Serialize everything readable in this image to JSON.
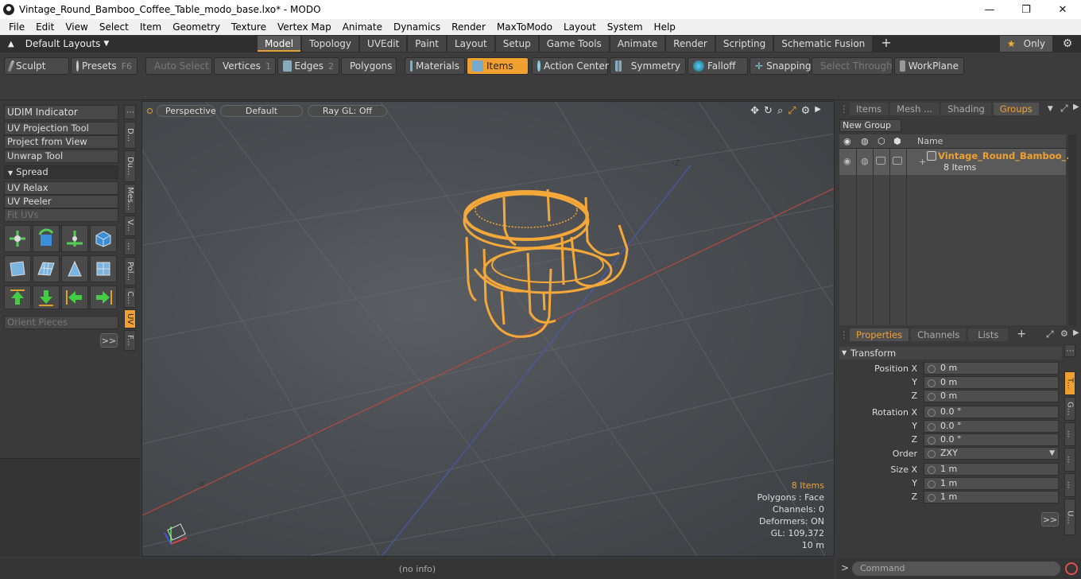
{
  "window": {
    "title": "Vintage_Round_Bamboo_Coffee_Table_modo_base.lxo* - MODO",
    "controls": [
      "—",
      "❐",
      "✕"
    ]
  },
  "menu": [
    "File",
    "Edit",
    "View",
    "Select",
    "Item",
    "Geometry",
    "Texture",
    "Vertex Map",
    "Animate",
    "Dynamics",
    "Render",
    "MaxToModo",
    "Layout",
    "System",
    "Help"
  ],
  "layouts": {
    "label": "Default Layouts"
  },
  "tabs": [
    "Model",
    "Topology",
    "UVEdit",
    "Paint",
    "Layout",
    "Setup",
    "Game Tools",
    "Animate",
    "Render",
    "Scripting",
    "Schematic Fusion"
  ],
  "active_tab": "Model",
  "only_label": "Only",
  "toolbar": {
    "sculpt": "Sculpt",
    "presets": "Presets",
    "presets_key": "F6",
    "auto_select": "Auto Select",
    "vertices": "Vertices",
    "vertices_key": "1",
    "edges": "Edges",
    "edges_key": "2",
    "polygons": "Polygons",
    "materials": "Materials",
    "items": "Items",
    "action_center": "Action Center",
    "symmetry": "Symmetry",
    "falloff": "Falloff",
    "snapping": "Snapping",
    "select_through": "Select Through",
    "workplane": "WorkPlane"
  },
  "left_tools": {
    "udim": "UDIM Indicator",
    "uv_projection": "UV Projection Tool",
    "project_from_view": "Project from View",
    "unwrap": "Unwrap Tool",
    "spread": "Spread",
    "uv_relax": "UV Relax",
    "uv_peeler": "UV Peeler",
    "fit_uvs": "Fit UVs",
    "orient_pieces": "Orient Pieces",
    "expand": ">>",
    "vtabs": [
      "D...",
      "Du...",
      "Mes...",
      "V...",
      "...",
      "Pol...",
      "C...",
      "UV",
      "F..."
    ]
  },
  "viewport": {
    "view": "Perspective",
    "shading": "Default",
    "raygl": "Ray GL: Off",
    "stats": {
      "items": "8 Items",
      "polygons": "Polygons : Face",
      "channels": "Channels: 0",
      "deformers": "Deformers: ON",
      "gl": "GL: 109,372",
      "scale": "10 m"
    }
  },
  "status": "(no info)",
  "groups_panel": {
    "tabs": [
      "Items",
      "Mesh ...",
      "Shading",
      "Groups"
    ],
    "active": "Groups",
    "new_group": "New Group",
    "col_name": "Name",
    "group_name": "Vintage_Round_Bamboo_...",
    "group_count": "8 Items"
  },
  "properties_panel": {
    "tabs": [
      "Properties",
      "Channels",
      "Lists"
    ],
    "active": "Properties",
    "section": "Transform",
    "position": {
      "label": "Position X",
      "x": "0 m",
      "y": "0 m",
      "z": "0 m"
    },
    "rotation": {
      "label": "Rotation X",
      "x": "0.0 °",
      "y": "0.0 °",
      "z": "0.0 °"
    },
    "order": {
      "label": "Order",
      "value": "ZXY"
    },
    "size": {
      "label": "Size X",
      "x": "1 m",
      "y": "1 m",
      "z": "1 m"
    },
    "axis_y": "Y",
    "axis_z": "Z",
    "expand": ">>",
    "vtabs": [
      "T...",
      "G...",
      "...",
      "...",
      "...",
      "U..."
    ]
  },
  "command": {
    "placeholder": "Command",
    "prompt": ">"
  },
  "colors": {
    "accent": "#f0a030",
    "mesh": "#f4a83a"
  }
}
